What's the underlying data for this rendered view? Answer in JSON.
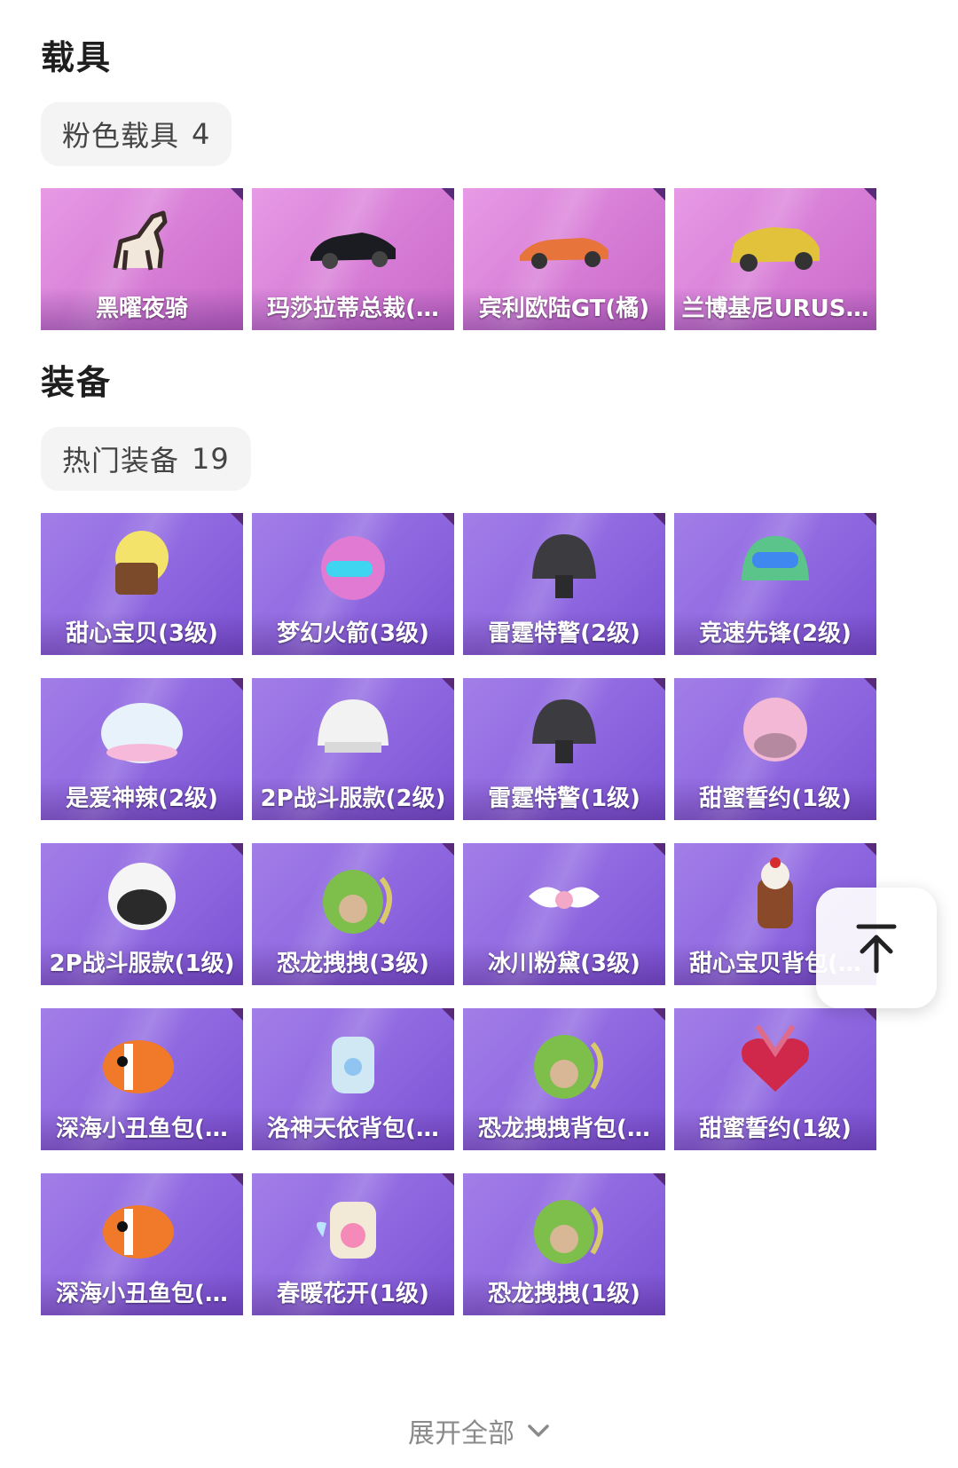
{
  "vehicles": {
    "title": "载具",
    "chip": {
      "label": "粉色载具",
      "count": "4"
    },
    "items": [
      {
        "name": "黑曜夜骑",
        "icon": "horse-icon"
      },
      {
        "name": "玛莎拉蒂总裁(…",
        "icon": "black-sedan-icon"
      },
      {
        "name": "宾利欧陆GT(橘)",
        "icon": "orange-convertible-icon"
      },
      {
        "name": "兰博基尼URUS…",
        "icon": "yellow-suv-icon"
      }
    ]
  },
  "equipment": {
    "title": "装备",
    "chip": {
      "label": "热门装备",
      "count": "19"
    },
    "items": [
      {
        "name": "甜心宝贝(3级)",
        "icon": "cupcake-helmet-icon"
      },
      {
        "name": "梦幻火箭(3级)",
        "icon": "rocket-helmet-icon"
      },
      {
        "name": "雷霆特警(2级)",
        "icon": "swat-helmet-icon"
      },
      {
        "name": "竞速先锋(2级)",
        "icon": "racer-helmet-icon"
      },
      {
        "name": "是爱神辣(2级)",
        "icon": "sheep-helmet-icon"
      },
      {
        "name": "2P战斗服款(2级)",
        "icon": "white-helmet-icon"
      },
      {
        "name": "雷霆特警(1级)",
        "icon": "swat-helmet-icon"
      },
      {
        "name": "甜蜜誓约(1级)",
        "icon": "pink-helmet-icon"
      },
      {
        "name": "2P战斗服款(1级)",
        "icon": "white-open-helmet-icon"
      },
      {
        "name": "恐龙拽拽(3级)",
        "icon": "dino-backpack-icon"
      },
      {
        "name": "冰川粉黛(3级)",
        "icon": "wing-backpack-icon"
      },
      {
        "name": "甜心宝贝背包(…",
        "icon": "cake-backpack-icon"
      },
      {
        "name": "深海小丑鱼包(…",
        "icon": "clownfish-backpack-icon"
      },
      {
        "name": "洛神天依背包(…",
        "icon": "blue-backpack-icon"
      },
      {
        "name": "恐龙拽拽背包(…",
        "icon": "dino-backpack-icon"
      },
      {
        "name": "甜蜜誓约(1级)",
        "icon": "heart-backpack-icon"
      },
      {
        "name": "深海小丑鱼包(…",
        "icon": "clownfish-backpack-icon"
      },
      {
        "name": "春暖花开(1级)",
        "icon": "flower-backpack-icon"
      },
      {
        "name": "恐龙拽拽(1级)",
        "icon": "dino-backpack-icon"
      }
    ]
  },
  "expand": {
    "label": "展开全部",
    "icon": "chevron-down-icon"
  },
  "back_to_top": {
    "icon": "arrow-up-icon"
  },
  "colors": {
    "pink_card": "#d77dd6",
    "purple_card": "#8e67e0",
    "chip_bg": "#f4f4f4"
  }
}
